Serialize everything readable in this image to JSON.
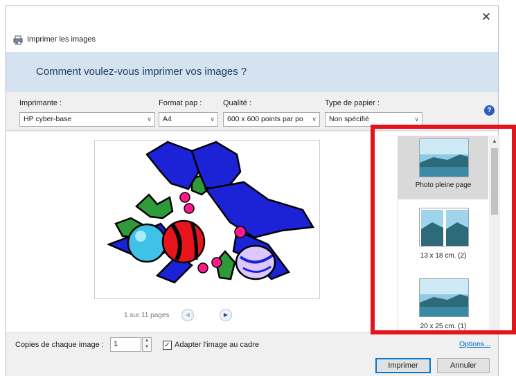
{
  "window": {
    "title": "Imprimer les images",
    "close_glyph": "✕",
    "title_icon": "printer-icon"
  },
  "banner": {
    "heading": "Comment voulez-vous imprimer vos images ?"
  },
  "print_options": {
    "printer": {
      "label": "Imprimante :",
      "value": "HP cyber-base"
    },
    "paper_size": {
      "label": "Format pap :",
      "value": "A4"
    },
    "quality": {
      "label": "Qualité :",
      "value": "600 x 600 points par po"
    },
    "paper_type": {
      "label": "Type de papier :",
      "value": "Non spécifié"
    },
    "dropdown_glyph": "∨",
    "help_glyph": "?"
  },
  "preview": {
    "image_description_icon": "christmas-ornaments-clipart",
    "pager_text": "1 sur 11 pages",
    "prev_glyph": "◀",
    "next_glyph": "▶"
  },
  "layouts": [
    {
      "label": "Photo pleine page",
      "selected": true
    },
    {
      "label": "13 x 18 cm. (2)",
      "selected": false
    },
    {
      "label": "20 x 25 cm. (1)",
      "selected": false
    }
  ],
  "settings": {
    "copies_label": "Copies de chaque image :",
    "copies_value": "1",
    "fit_label": "Adapter l'image au cadre",
    "fit_checked": true,
    "check_glyph": "✓",
    "options_link": "Options..."
  },
  "buttons": {
    "print": "Imprimer",
    "cancel": "Annuler"
  },
  "colors": {
    "banner_bg": "#d4e3ef",
    "highlight_border": "#e4141c",
    "link": "#0066cc"
  }
}
